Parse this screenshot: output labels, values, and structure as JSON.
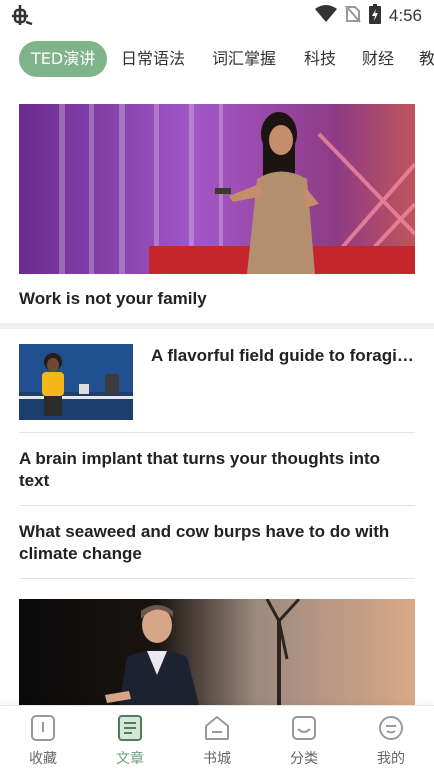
{
  "status_bar": {
    "time": "4:56",
    "app_icon": "bug-icon",
    "icons": [
      "wifi-icon",
      "no-sim-icon",
      "battery-icon"
    ]
  },
  "tabs": [
    {
      "label": "TED演讲",
      "active": true
    },
    {
      "label": "日常语法",
      "active": false
    },
    {
      "label": "词汇掌握",
      "active": false
    },
    {
      "label": "科技",
      "active": false
    },
    {
      "label": "财经",
      "active": false
    },
    {
      "label": "教",
      "active": false
    }
  ],
  "articles": {
    "hero": {
      "title": "Work is not your family"
    },
    "item1": {
      "title": "A flavorful field guide to foragi…"
    },
    "item2": {
      "title": "A brain implant that turns your thoughts into text"
    },
    "item3": {
      "title": "What seaweed and cow burps have to do with climate change"
    }
  },
  "bottom_nav": [
    {
      "label": "收藏",
      "icon": "favorites-icon",
      "active": false
    },
    {
      "label": "文章",
      "icon": "article-icon",
      "active": true
    },
    {
      "label": "书城",
      "icon": "bookstore-icon",
      "active": false
    },
    {
      "label": "分类",
      "icon": "category-icon",
      "active": false
    },
    {
      "label": "我的",
      "icon": "profile-icon",
      "active": false
    }
  ],
  "colors": {
    "accent": "#7fb389",
    "active_nav": "#6e9e78"
  }
}
